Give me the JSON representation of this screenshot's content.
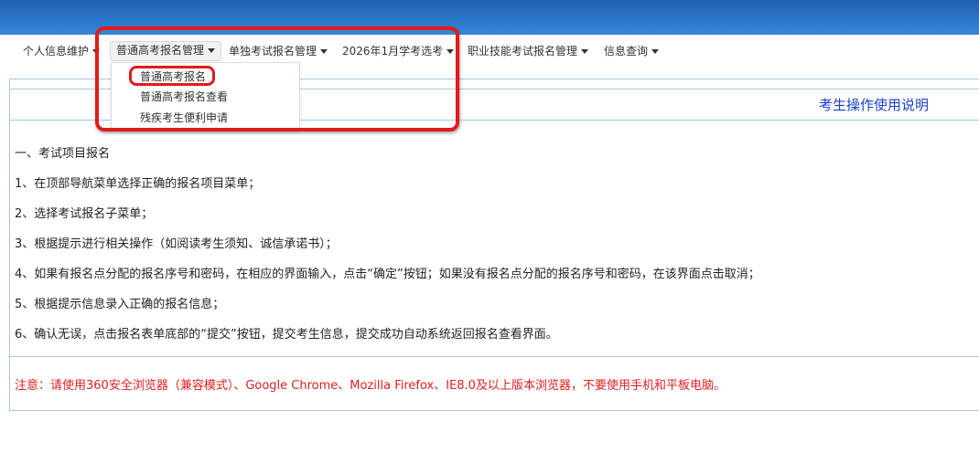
{
  "nav": {
    "items": [
      {
        "label": "个人信息维护"
      },
      {
        "label": "普通高考报名管理"
      },
      {
        "label": "单独考试报名管理"
      },
      {
        "label": "2026年1月学考选考"
      },
      {
        "label": "职业技能考试报名管理"
      },
      {
        "label": "信息查询"
      }
    ]
  },
  "dropdown": {
    "items": [
      {
        "label": "普通高考报名"
      },
      {
        "label": "普通高考报名查看"
      },
      {
        "label": "残疾考生便利申请"
      }
    ]
  },
  "guide_link": "考生操作使用说明",
  "steps": [
    "一、考试项目报名",
    "1、在顶部导航菜单选择正确的报名项目菜单；",
    "2、选择考试报名子菜单；",
    "3、根据提示进行相关操作（如阅读考生须知、诚信承诺书）；",
    "4、如果有报名点分配的报名序号和密码，在相应的界面输入，点击“确定”按钮；如果没有报名点分配的报名序号和密码，在该界面点击取消；",
    "5、根据提示信息录入正确的报名信息；",
    "6、确认无误，点击报名表单底部的“提交”按钮，提交考生信息，提交成功自动系统返回报名查看界面。"
  ],
  "notice": "注意：请使用360安全浏览器（兼容模式）、Google Chrome、Mozilla Firefox、IE8.0及以上版本浏览器，不要使用手机和平板电脑。",
  "colors": {
    "banner": "#2a78cc",
    "highlight": "#e31b1b",
    "link": "#1a3fc9",
    "notice": "#e02020",
    "border": "#a8c6e2"
  }
}
